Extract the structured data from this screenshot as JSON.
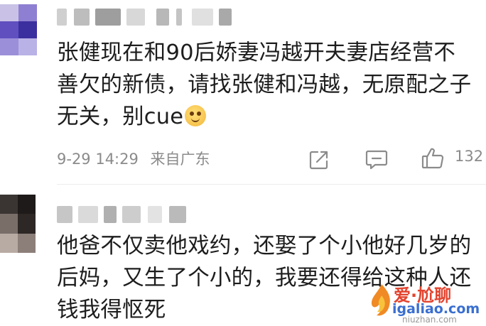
{
  "comments": [
    {
      "lines": [
        "张健现在和90后娇妻冯越开夫妻店经营不",
        "善欠的新债，请找张健和冯越，无原配之子",
        "无关，别cue"
      ],
      "emoji": "smile-emoji",
      "date": "9-29 14:29",
      "source": "来自广东",
      "like_count": "132"
    },
    {
      "lines": [
        "他爸不仅卖他戏约，还娶了个小他好几岁的",
        "后妈，又生了个小的，我要还得给这种人还",
        "钱我得怄死"
      ]
    }
  ],
  "watermark": {
    "line1": "爱·尬聊",
    "line2": "igaliao.com",
    "line3": "niuzhan.com"
  },
  "colors": {
    "text": "#1d1d1d",
    "meta": "#8b8b8b",
    "icon": "#8b8b8b",
    "watermark_red": "#e2442f",
    "watermark_blue": "#3a6fd0"
  }
}
